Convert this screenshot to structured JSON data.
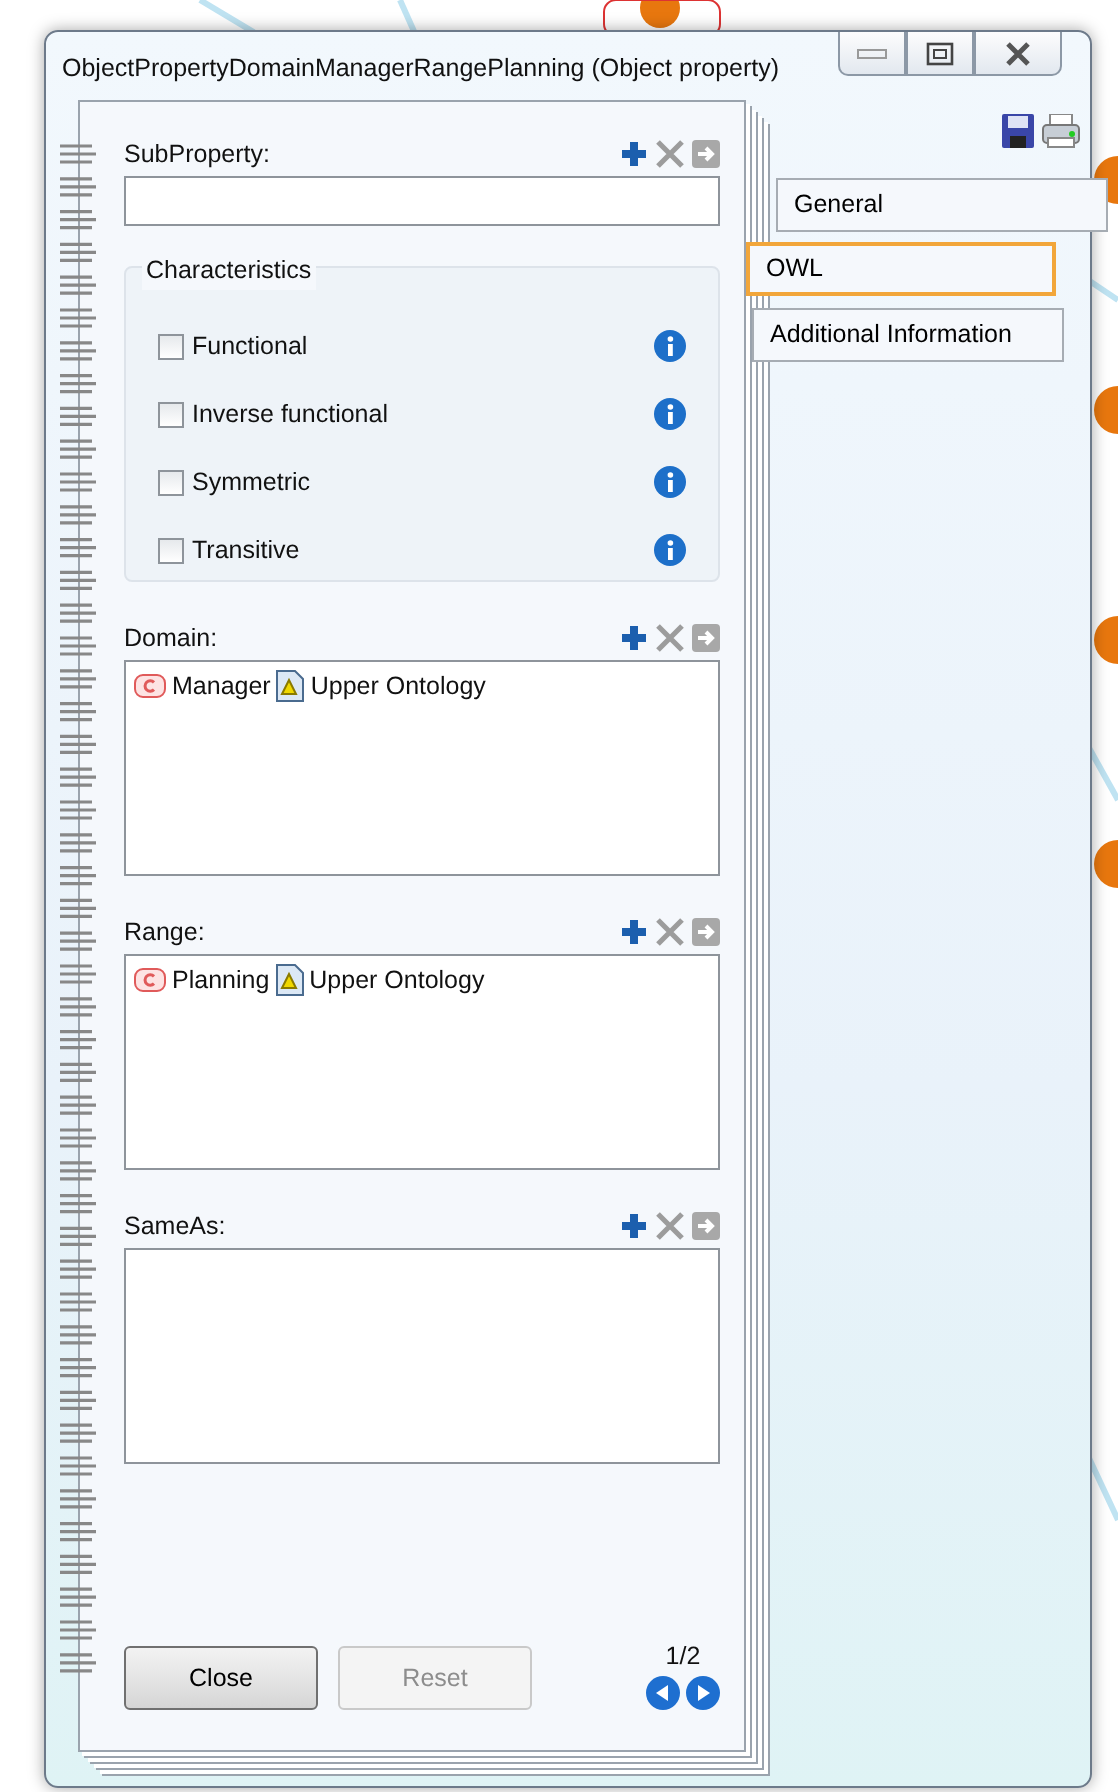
{
  "window": {
    "title": "ObjectPropertyDomainManagerRangePlanning (Object property)"
  },
  "subproperty": {
    "label": "SubProperty:"
  },
  "characteristics": {
    "title": "Characteristics",
    "items": [
      {
        "label": "Functional",
        "checked": false
      },
      {
        "label": "Inverse functional",
        "checked": false
      },
      {
        "label": "Symmetric",
        "checked": false
      },
      {
        "label": "Transitive",
        "checked": false
      }
    ]
  },
  "lists": [
    {
      "label": "Domain:",
      "items": [
        {
          "name": "Manager",
          "ontology": "Upper Ontology"
        }
      ]
    },
    {
      "label": "Range:",
      "items": [
        {
          "name": "Planning",
          "ontology": "Upper Ontology"
        }
      ]
    },
    {
      "label": "SameAs:"
    }
  ],
  "buttons": [
    {
      "label": "Close",
      "disabled": false
    },
    {
      "label": "Reset",
      "disabled": true
    }
  ],
  "pager": "1/2",
  "tabs": [
    {
      "label": "General",
      "selected": false
    },
    {
      "label": "OWL",
      "selected": true
    },
    {
      "label": "Additional Information",
      "selected": false
    }
  ]
}
